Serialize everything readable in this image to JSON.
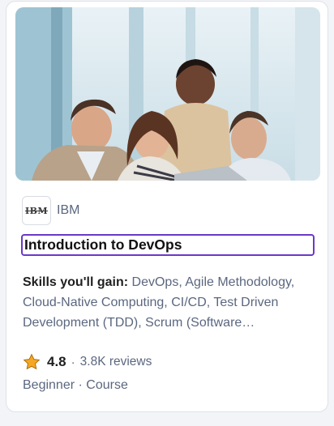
{
  "partner": {
    "name": "IBM",
    "logo_text": "IBM"
  },
  "course": {
    "title": "Introduction to DevOps",
    "skills_label": "Skills you'll gain:",
    "skills": "DevOps, Agile Methodology, Cloud-Native Computing, CI/CD, Test Driven Development (TDD), Scrum (Software…"
  },
  "rating": {
    "value": "4.8",
    "separator": "·",
    "reviews": "3.8K reviews"
  },
  "meta": {
    "level": "Beginner",
    "separator": " · ",
    "type": "Course"
  },
  "colors": {
    "focus_ring": "#6a39c9",
    "star": "#f5a623",
    "muted_text": "#5b6780"
  },
  "icons": {
    "rating": "star-icon"
  }
}
